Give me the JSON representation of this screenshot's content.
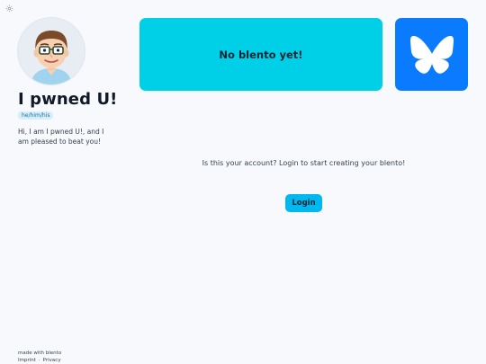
{
  "icons": {
    "corner": "gear-icon",
    "avatar": "cartoon-avatar",
    "social": "butterfly-icon"
  },
  "profile": {
    "name": "I pwned U!",
    "pronouns": "he/him/his",
    "bio": "Hi, I am I pwned U!, and I am pleased to beat you!"
  },
  "cards": {
    "empty_text": "No blento yet!"
  },
  "main": {
    "prompt": "Is this your account? Login to start creating your blento!",
    "login_label": "Login"
  },
  "footer": {
    "made_with": "made with blento",
    "imprint": "Imprint",
    "separator": "·",
    "privacy": "Privacy"
  },
  "colors": {
    "card_cyan": "#00cfe8",
    "bluesky_blue": "#0a7aff",
    "login_button": "#00b8f0",
    "background": "#f7f9fc"
  }
}
